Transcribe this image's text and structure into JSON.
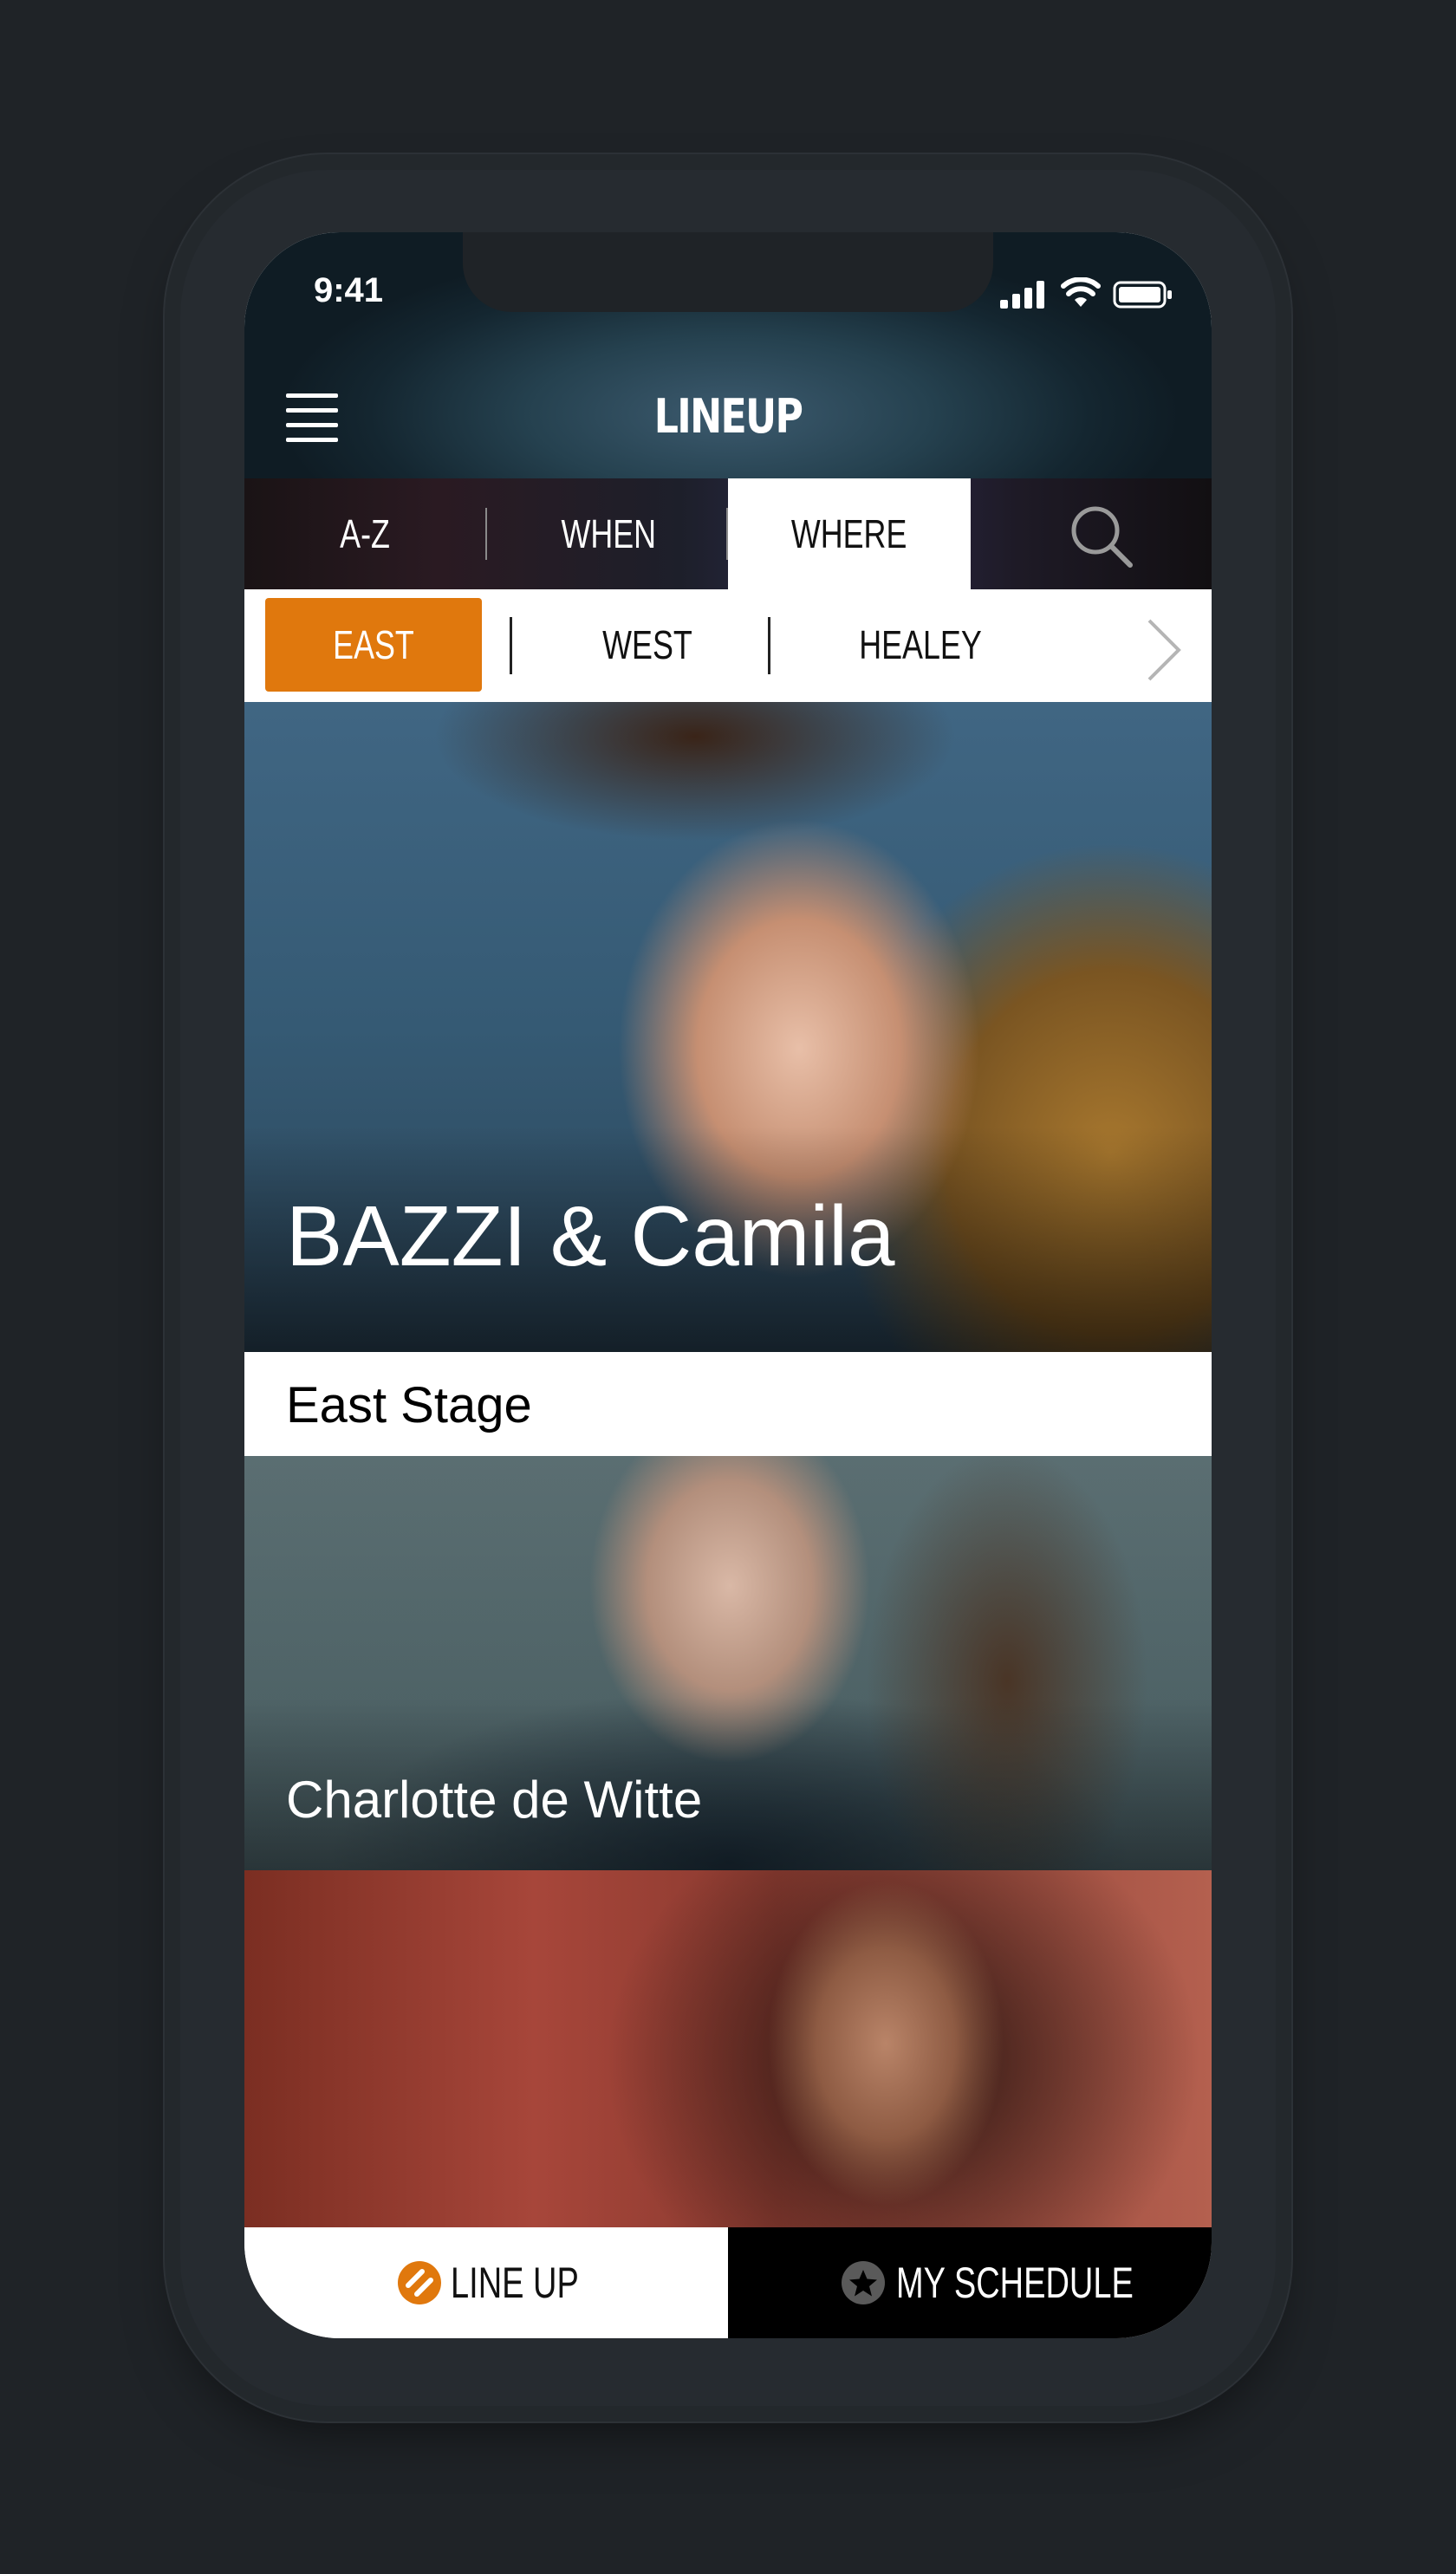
{
  "status_bar": {
    "time": "9:41"
  },
  "header": {
    "title": "LINEUP",
    "menu_icon": "hamburger-menu-icon"
  },
  "tabs": [
    {
      "label": "A-Z",
      "selected": false
    },
    {
      "label": "WHEN",
      "selected": false
    },
    {
      "label": "WHERE",
      "selected": true
    }
  ],
  "search_icon": "search-icon",
  "stages": [
    {
      "label": "EAST STAGE",
      "selected": true
    },
    {
      "label": "WEST STAGE",
      "selected": false
    },
    {
      "label": "HEALEY STAGE",
      "selected": false
    }
  ],
  "cards": [
    {
      "artist": "BAZZI & Camila"
    },
    {
      "artist": "Charlotte de Witte"
    },
    {
      "artist": ""
    }
  ],
  "current_stage_label": "East Stage",
  "bottom_nav": {
    "lineup_label": "LINE UP",
    "schedule_label": "MY SCHEDULE"
  },
  "colors": {
    "accent": "#e0780d",
    "background": "#1f2327",
    "nav_dark": "#000000"
  }
}
